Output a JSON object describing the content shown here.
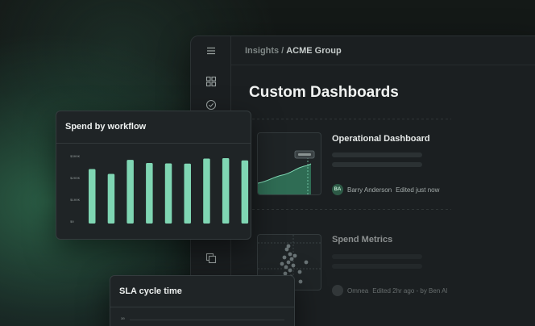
{
  "breadcrumb": {
    "parent": "Insights",
    "separator": "/",
    "current": "ACME Group"
  },
  "page": {
    "title": "Custom Dashboards"
  },
  "rail_icons": [
    "menu-icon",
    "grid-icon",
    "check-circle-icon",
    "copy-icon"
  ],
  "dashboards": [
    {
      "title": "Operational Dashboard",
      "avatar": "BA",
      "owner": "Barry Anderson",
      "status": "Edited just now"
    },
    {
      "title": "Spend Metrics",
      "avatar": "",
      "owner": "Omnea",
      "status": "Edited 2hr ago - by Ben Al"
    }
  ],
  "spend_panel": {
    "title": "Spend by workflow"
  },
  "sla_panel": {
    "title": "SLA cycle time",
    "first_tick": "30"
  },
  "chart_data": {
    "type": "bar",
    "title": "Spend by workflow",
    "categories": [
      "",
      "",
      "",
      "",
      "",
      "",
      "",
      "",
      ""
    ],
    "values": [
      250,
      228,
      292,
      278,
      276,
      275,
      298,
      300,
      290
    ],
    "ylim": [
      0,
      300
    ],
    "yticks": [
      "$300K",
      "$200K",
      "$100K",
      "$0"
    ],
    "bar_color": "#7fd6b3"
  },
  "colors": {
    "accent": "#7fd6b3",
    "background": "#161a1c"
  }
}
